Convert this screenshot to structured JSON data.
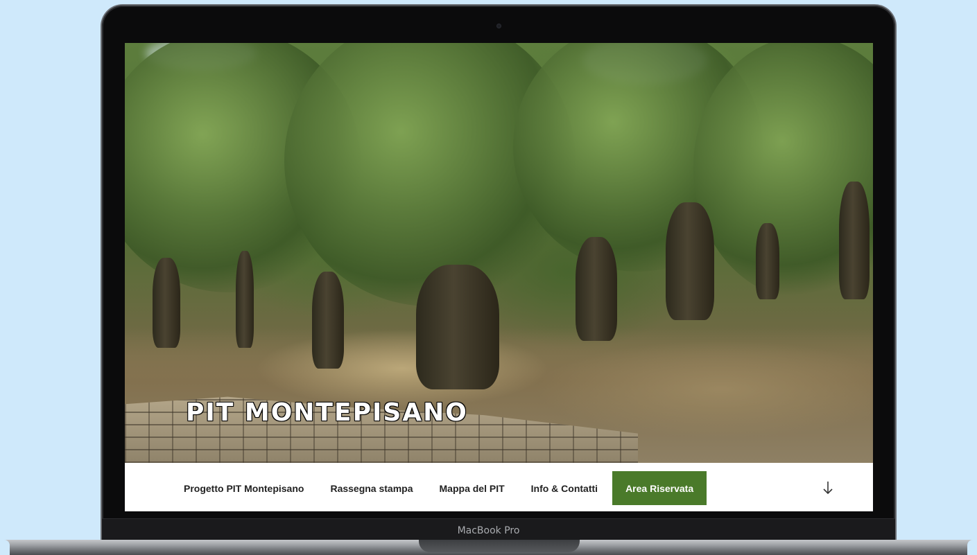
{
  "site": {
    "title": "PIT MONTEPISANO"
  },
  "nav": {
    "items": [
      {
        "label": "Progetto PIT Montepisano"
      },
      {
        "label": "Rassegna stampa"
      },
      {
        "label": "Mappa del PIT"
      },
      {
        "label": "Info & Contatti"
      },
      {
        "label": "Area Riservata",
        "highlight": true
      }
    ],
    "scroll_icon": "arrow-down-icon"
  },
  "device": {
    "brand": "MacBook Pro"
  },
  "colors": {
    "background": "#cfe9fb",
    "nav_highlight": "#4a7a2a",
    "nav_text": "#222222"
  }
}
